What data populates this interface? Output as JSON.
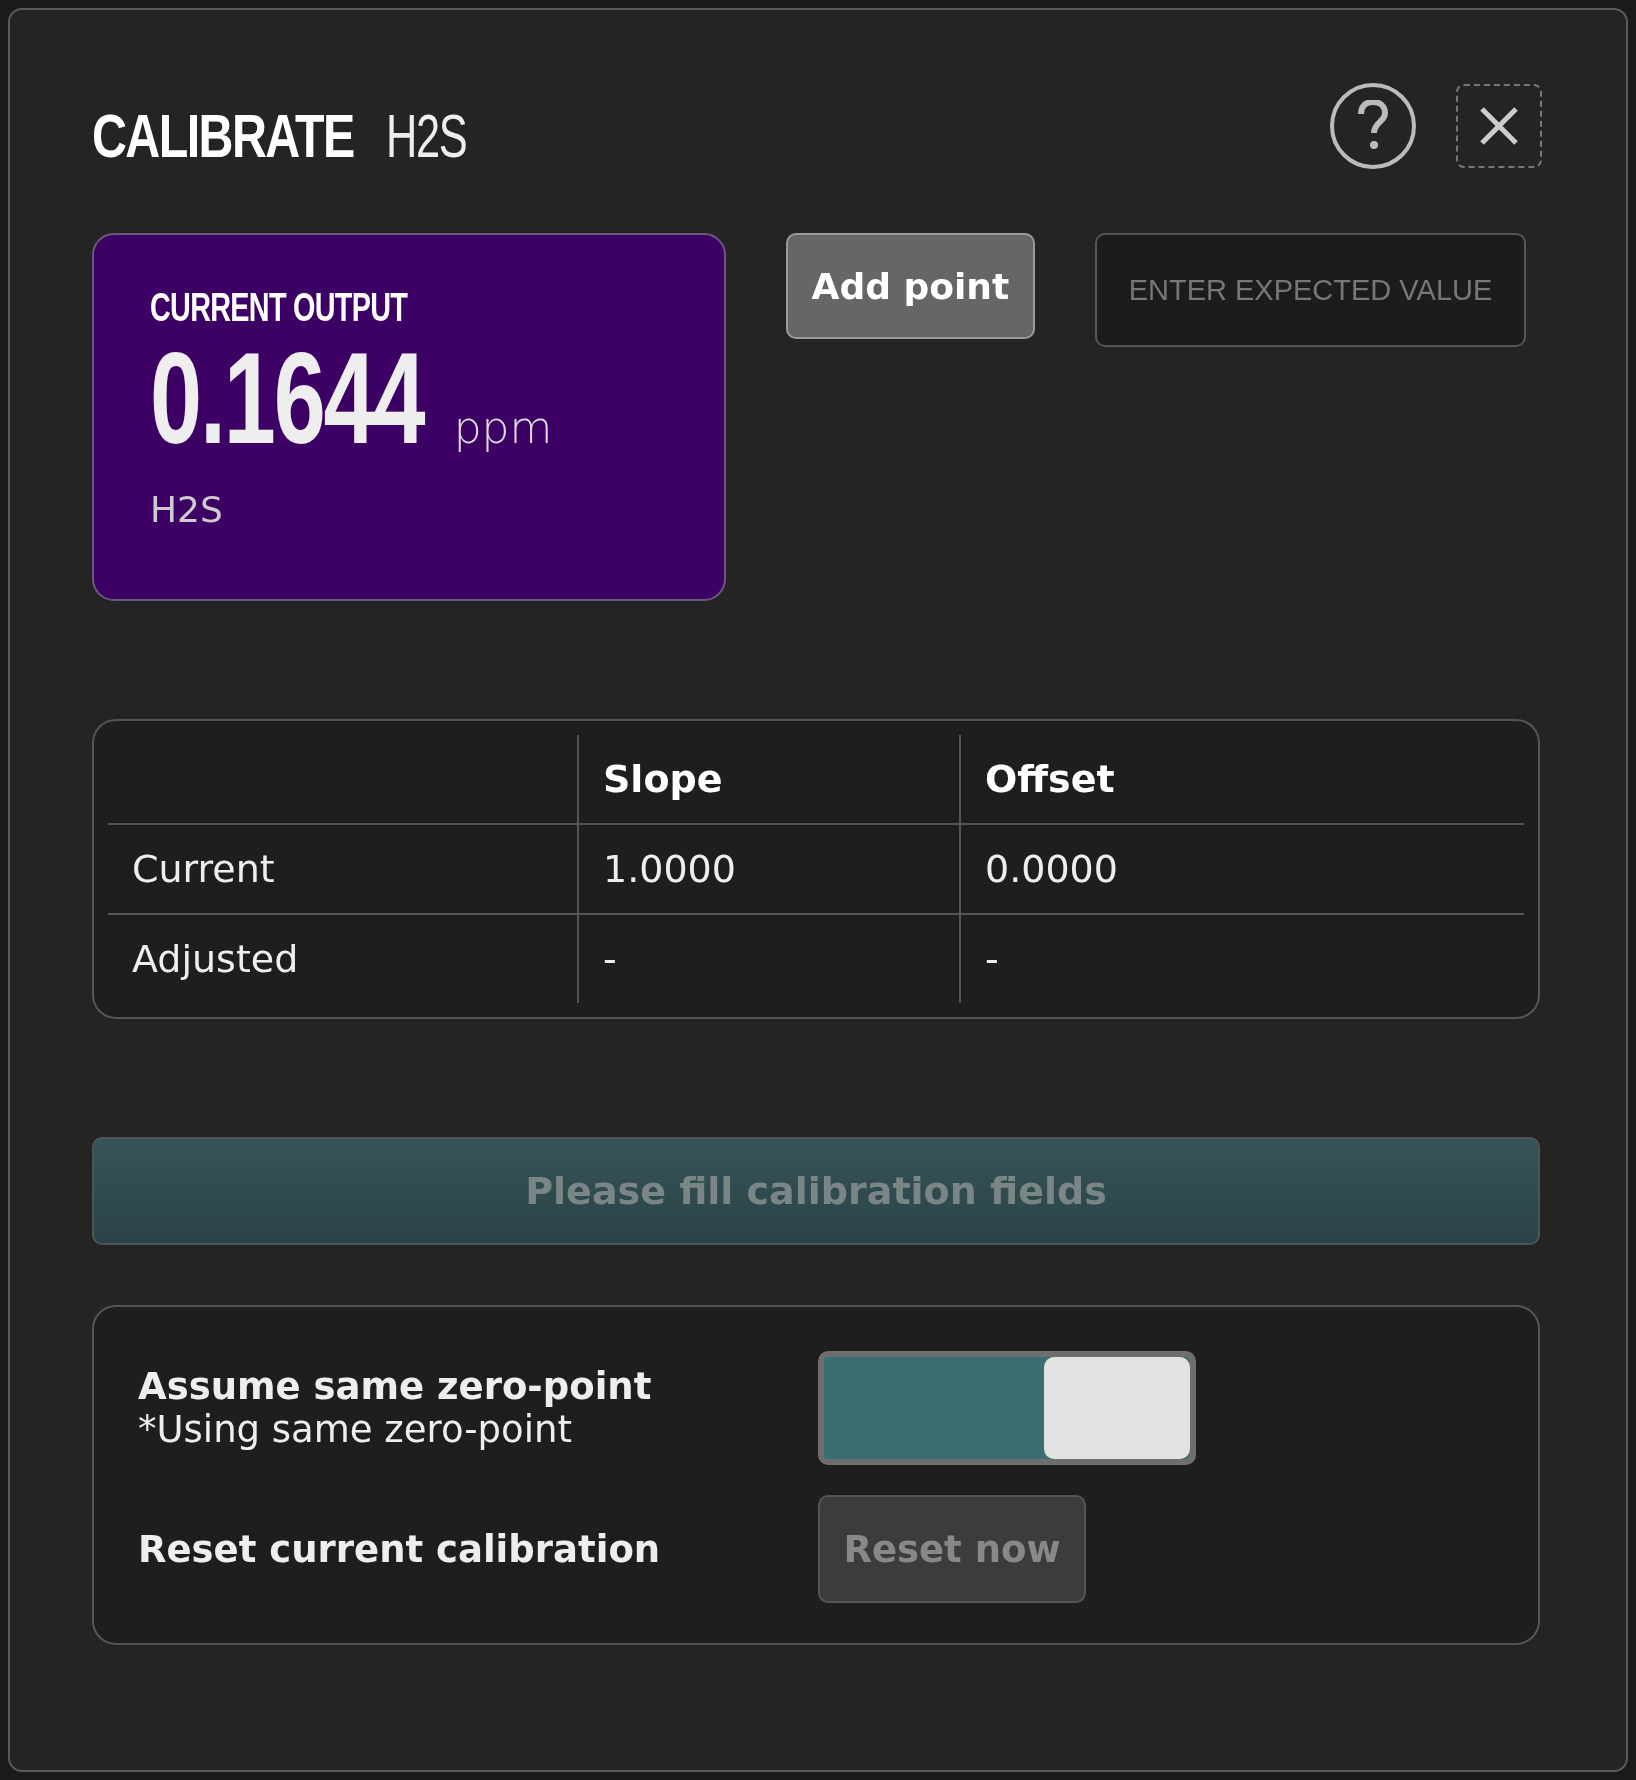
{
  "dialog": {
    "title": "CALIBRATE",
    "subtitle": "H2S"
  },
  "output": {
    "label": "CURRENT OUTPUT",
    "value": "0.1644",
    "unit": "ppm",
    "gas": "H2S"
  },
  "add_button": "Add point",
  "expected_field": {
    "placeholder": "ENTER EXPECTED VALUE"
  },
  "table": {
    "columns": [
      "Slope",
      "Offset"
    ],
    "rows": [
      {
        "label": "Current",
        "cells": [
          "1.0000",
          "0.0000"
        ]
      },
      {
        "label": "Adjusted",
        "cells": [
          "-",
          "-"
        ]
      }
    ]
  },
  "submit_button": {
    "label": "Please fill calibration fields",
    "disabled": true
  },
  "options": {
    "zero_point": {
      "label": "Assume same zero-point",
      "note": "*Using same zero-point",
      "on": true
    },
    "reset": {
      "label": "Reset current calibration",
      "button": "Reset now",
      "disabled": true
    }
  }
}
